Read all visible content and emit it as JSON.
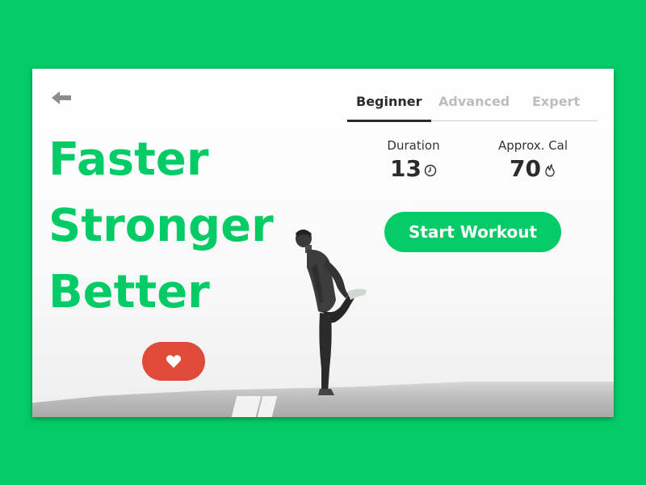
{
  "colors": {
    "page_background": "#03cc67",
    "accent_green": "#03cc67",
    "like_red": "#e04a38",
    "text_dark": "#2b2b2b",
    "tab_inactive": "#bdbdbd"
  },
  "header": {
    "back_icon": "back-arrow-icon"
  },
  "hero": {
    "line1": "Faster",
    "line2": "Stronger",
    "line3": "Better"
  },
  "like": {
    "icon": "heart-icon"
  },
  "tabs": [
    {
      "label": "Beginner",
      "active": true
    },
    {
      "label": "Advanced",
      "active": false
    },
    {
      "label": "Expert",
      "active": false
    }
  ],
  "stats": {
    "duration": {
      "label": "Duration",
      "value": "13",
      "icon": "clock-icon"
    },
    "calories": {
      "label": "Approx. Cal",
      "value": "70",
      "icon": "flame-icon"
    }
  },
  "start_button": {
    "label": "Start Workout"
  }
}
